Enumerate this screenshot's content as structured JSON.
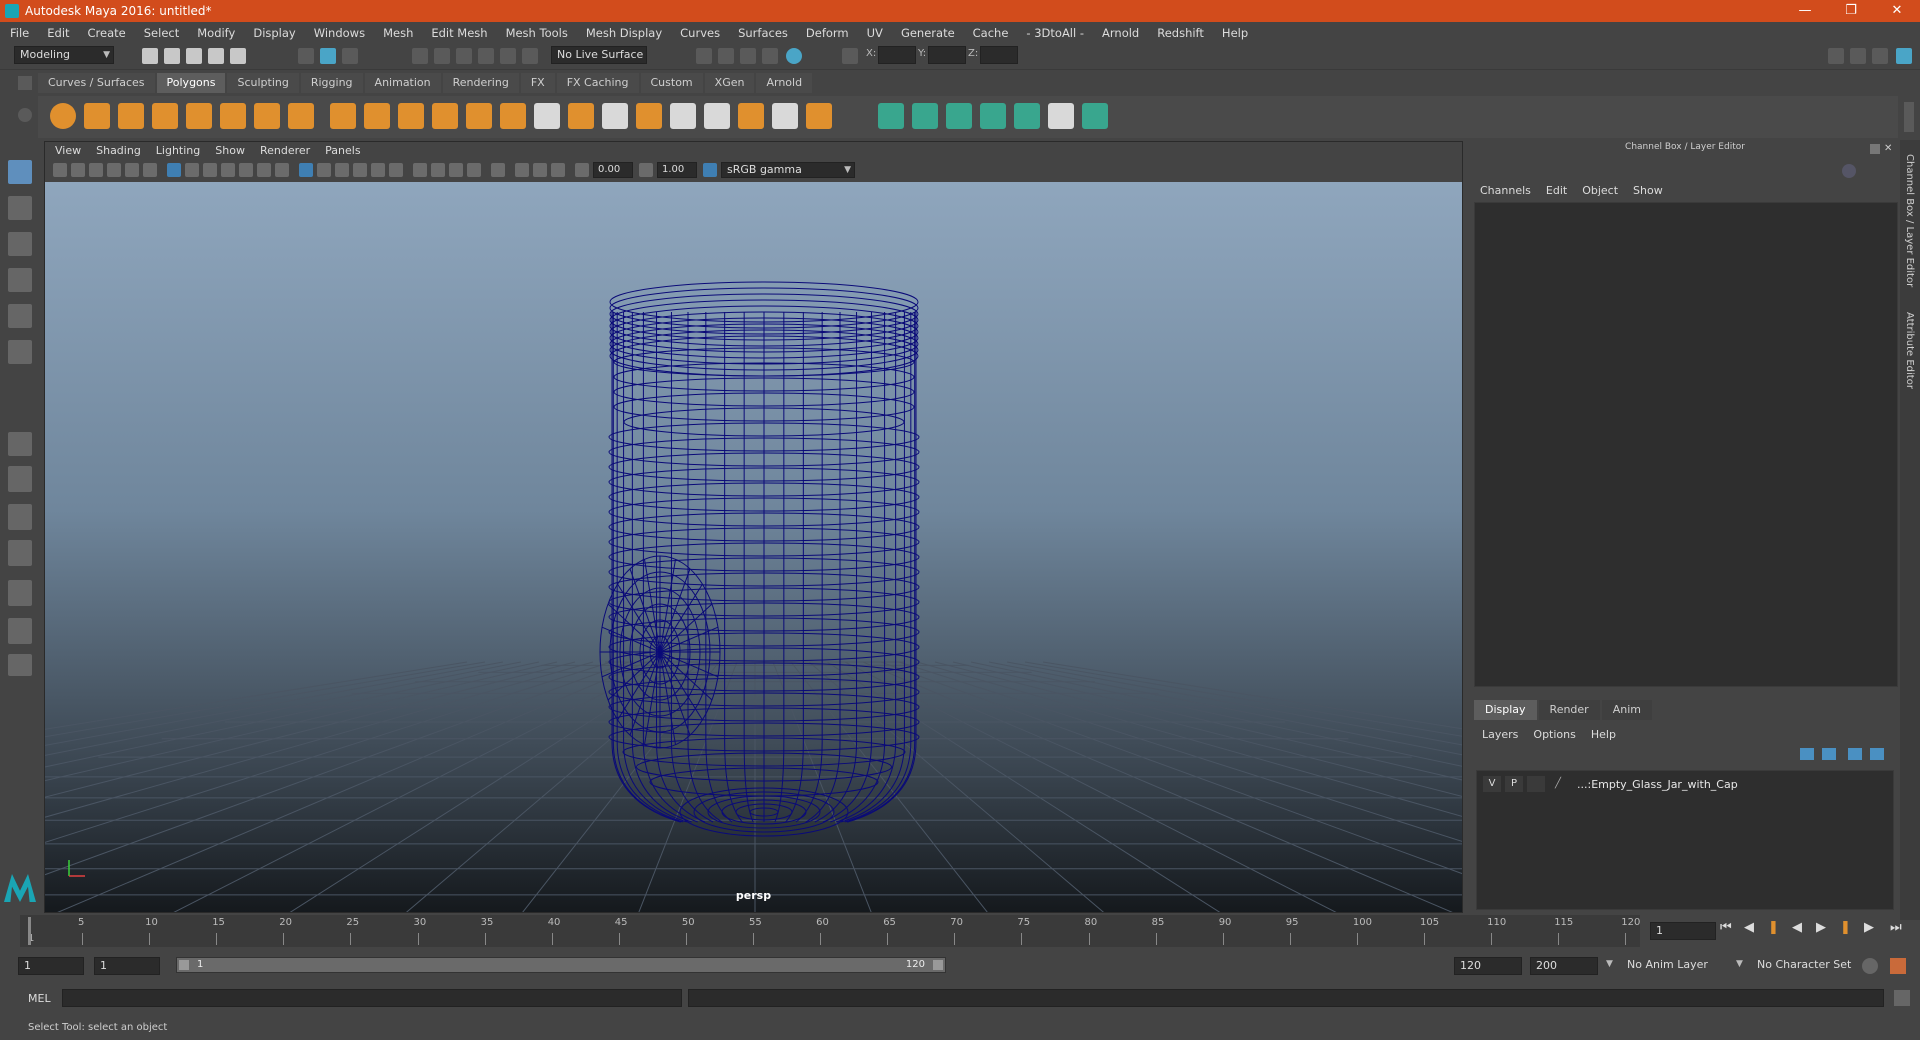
{
  "titlebar": {
    "title": "Autodesk Maya 2016: untitled*",
    "minimize": "—",
    "restore": "❐",
    "close": "✕"
  },
  "menubar": {
    "items": [
      "File",
      "Edit",
      "Create",
      "Select",
      "Modify",
      "Display",
      "Windows",
      "Mesh",
      "Edit Mesh",
      "Mesh Tools",
      "Mesh Display",
      "Curves",
      "Surfaces",
      "Deform",
      "UV",
      "Generate",
      "Cache",
      "- 3DtoAll -",
      "Arnold",
      "Redshift",
      "Help"
    ]
  },
  "statusline": {
    "mode": "Modeling",
    "live_surface": "No Live Surface",
    "x_label": "X:",
    "y_label": "Y:",
    "z_label": "Z:"
  },
  "shelf": {
    "tabs": [
      "Curves / Surfaces",
      "Polygons",
      "Sculpting",
      "Rigging",
      "Animation",
      "Rendering",
      "FX",
      "FX Caching",
      "Custom",
      "XGen",
      "Arnold"
    ],
    "active_tab": "Polygons"
  },
  "viewport": {
    "menu": [
      "View",
      "Shading",
      "Lighting",
      "Show",
      "Renderer",
      "Panels"
    ],
    "exposure": "0.00",
    "gamma": "1.00",
    "color_space": "sRGB gamma",
    "camera_label": "persp",
    "wire_color": "#0a0a78"
  },
  "right_panel": {
    "title": "Channel Box / Layer Editor",
    "menu": [
      "Channels",
      "Edit",
      "Object",
      "Show"
    ],
    "tabs": [
      "Display",
      "Render",
      "Anim"
    ],
    "active_tab": "Display",
    "layer_menu": [
      "Layers",
      "Options",
      "Help"
    ],
    "layer": {
      "visible": "V",
      "playback": "P",
      "name": "...:Empty_Glass_Jar_with_Cap"
    }
  },
  "side_tabs": [
    "Channel Box / Layer Editor",
    "Attribute Editor"
  ],
  "timeline": {
    "ticks": [
      "5",
      "10",
      "15",
      "20",
      "25",
      "30",
      "35",
      "40",
      "45",
      "50",
      "55",
      "60",
      "65",
      "70",
      "75",
      "80",
      "85",
      "90",
      "95",
      "100",
      "105",
      "110",
      "115",
      "120"
    ],
    "start_marker": "1",
    "current_frame": "1"
  },
  "range": {
    "start": "1",
    "playback_start": "1",
    "slider_start": "1",
    "slider_end": "120",
    "playback_end": "120",
    "end": "200",
    "anim_layer": "No Anim Layer",
    "char_set": "No Character Set"
  },
  "cmdline": {
    "label": "MEL"
  },
  "helpline": {
    "text": "Select Tool: select an object"
  }
}
